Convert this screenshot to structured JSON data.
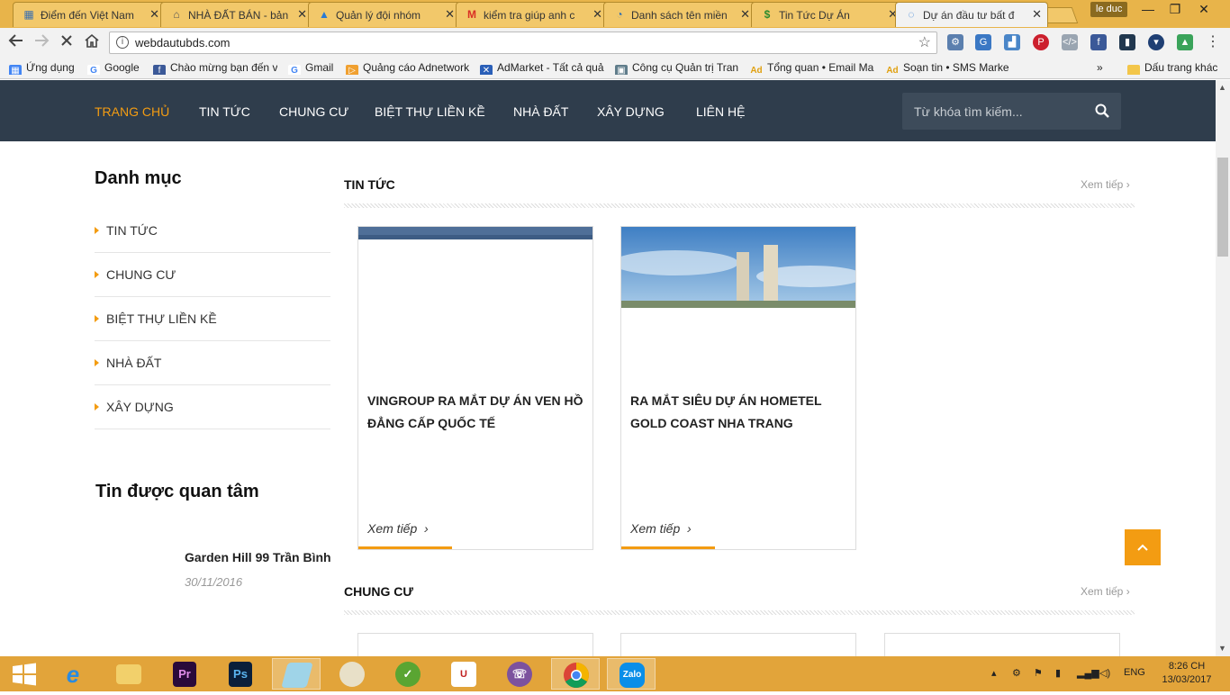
{
  "browser": {
    "tabs": [
      {
        "title": "Điểm đến Việt Nam",
        "icon": "map-icon",
        "active": false
      },
      {
        "title": "NHÀ ĐẤT BÁN - bản",
        "icon": "house-icon",
        "active": false
      },
      {
        "title": "Quản lý đội nhóm",
        "icon": "adwords-icon",
        "active": false
      },
      {
        "title": "kiểm tra giúp anh c",
        "icon": "gmail-icon",
        "active": false
      },
      {
        "title": "Danh sách tên miền",
        "icon": "cloud-icon",
        "active": false
      },
      {
        "title": "Tin Tức Dự Án",
        "icon": "dollar-icon",
        "active": false
      },
      {
        "title": "Dự án đầu tư bất đ",
        "icon": "loading-icon",
        "active": true
      }
    ],
    "user": "le duc",
    "url": "webdautubds.com",
    "bookmarks": [
      {
        "label": "Ứng dụng",
        "icon": "apps-icon"
      },
      {
        "label": "Google",
        "icon": "google-icon"
      },
      {
        "label": "Chào mừng bạn đến v",
        "icon": "facebook-icon"
      },
      {
        "label": "Gmail",
        "icon": "google-icon"
      },
      {
        "label": "Quảng cáo Adnetwork",
        "icon": "adnetwork-icon"
      },
      {
        "label": "AdMarket - Tất cả quả",
        "icon": "admarket-icon"
      },
      {
        "label": "Công cụ Quản trị Tran",
        "icon": "webmaster-icon"
      },
      {
        "label": "Tổng quan • Email Ma",
        "icon": "ad-icon"
      },
      {
        "label": "Soạn tin • SMS Marke",
        "icon": "ad-icon"
      }
    ],
    "bookmarks_more": "»",
    "other_bookmarks": "Dấu trang khác"
  },
  "site": {
    "nav": [
      {
        "label": "TRANG CHỦ",
        "active": true
      },
      {
        "label": "TIN TỨC",
        "active": false
      },
      {
        "label": "CHUNG CƯ",
        "active": false
      },
      {
        "label": "BIỆT THỰ LIỀN KỀ",
        "active": false
      },
      {
        "label": "NHÀ ĐẤT",
        "active": false
      },
      {
        "label": "XÂY DỰNG",
        "active": false
      },
      {
        "label": "LIÊN HỆ",
        "active": false
      }
    ],
    "search_placeholder": "Từ khóa tìm kiếm...",
    "sidebar": {
      "title": "Danh mục",
      "categories": [
        "TIN TỨC",
        "CHUNG CƯ",
        "BIỆT THỰ LIỀN KỀ",
        "NHÀ ĐẤT",
        "XÂY DỰNG"
      ],
      "featured_title": "Tin được quan tâm",
      "featured_posts": [
        {
          "title": "Garden Hill 99 Trần Bình",
          "date": "30/11/2016"
        }
      ]
    },
    "sections": [
      {
        "title": "TIN TỨC",
        "more": "Xem tiếp",
        "cards": [
          {
            "title": "VINGROUP RA MẮT DỰ ÁN VEN HỒ ĐẲNG CẤP QUỐC TẾ",
            "read_more": "Xem tiếp"
          },
          {
            "title": "RA MẮT SIÊU DỰ ÁN HOMETEL GOLD COAST NHA TRANG",
            "read_more": "Xem tiếp"
          }
        ]
      },
      {
        "title": "CHUNG CƯ",
        "more": "Xem tiếp",
        "cards": []
      }
    ]
  },
  "taskbar": {
    "apps": [
      {
        "name": "windows-start-icon",
        "selected": false
      },
      {
        "name": "internet-explorer-icon",
        "selected": false
      },
      {
        "name": "file-explorer-icon",
        "selected": false
      },
      {
        "name": "premiere-icon",
        "label": "Pr",
        "selected": false
      },
      {
        "name": "photoshop-icon",
        "label": "Ps",
        "selected": false
      },
      {
        "name": "notepad-icon",
        "selected": true
      },
      {
        "name": "paint-icon",
        "selected": false
      },
      {
        "name": "coccoc-icon",
        "selected": false
      },
      {
        "name": "unikey-icon",
        "selected": false
      },
      {
        "name": "viber-icon",
        "selected": false
      },
      {
        "name": "chrome-icon",
        "selected": true
      },
      {
        "name": "zalo-icon",
        "label": "Zalo",
        "selected": true
      }
    ],
    "language": "ENG",
    "time": "8:26 CH",
    "date": "13/03/2017"
  },
  "colors": {
    "tabstrip": "#e8b44a",
    "nav_bg": "#2f3d4c",
    "accent": "#f39c12",
    "taskbar": "#e2a43a"
  }
}
